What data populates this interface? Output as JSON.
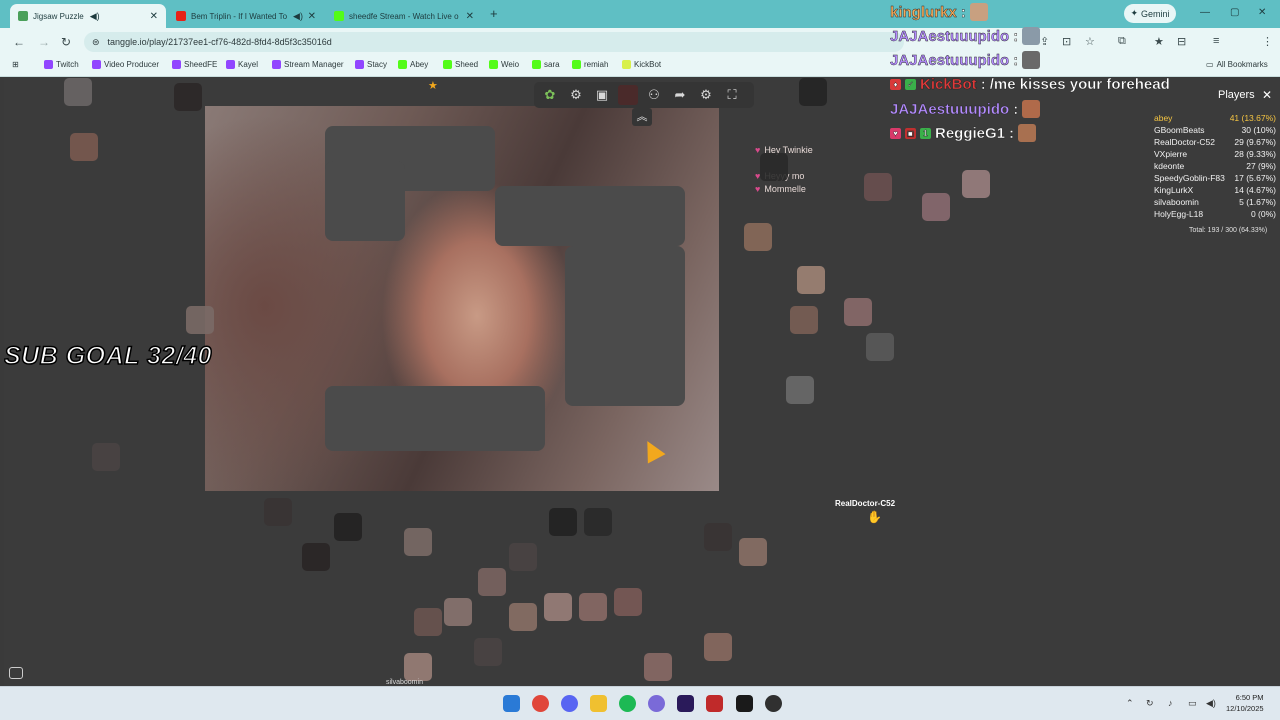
{
  "browser": {
    "tabs": [
      {
        "title": "Jigsaw Puzzle",
        "active": true,
        "color": "#4aa05a"
      },
      {
        "title": "Bem Triplin - If I Wanted To",
        "active": false,
        "color": "#e62117"
      },
      {
        "title": "sheedfe Stream - Watch Live o",
        "active": false,
        "color": "#53fc18"
      }
    ],
    "gemini_label": "Gemini",
    "url": "tanggle.io/play/21737ee1-cf76-482d-8fd4-8d5f3c35016d",
    "bookmarks": [
      {
        "label": "Twitch",
        "color": "#9146ff"
      },
      {
        "label": "Video Producer",
        "color": "#9146ff"
      },
      {
        "label": "SheedFE",
        "color": "#9146ff"
      },
      {
        "label": "Kayel",
        "color": "#9146ff"
      },
      {
        "label": "Stream Manager",
        "color": "#9146ff"
      },
      {
        "label": "Stacy",
        "color": "#9146ff"
      },
      {
        "label": "Abey",
        "color": "#53fc18"
      },
      {
        "label": "Sheed",
        "color": "#53fc18"
      },
      {
        "label": "Weio",
        "color": "#53fc18"
      },
      {
        "label": "sara",
        "color": "#53fc18"
      },
      {
        "label": "remiah",
        "color": "#53fc18"
      },
      {
        "label": "KickBot",
        "color": "#d8f04a"
      }
    ],
    "all_bookmarks_label": "All Bookmarks"
  },
  "overlay": {
    "sub_goal": "SUB GOAL 32/40",
    "chat": [
      {
        "user": "kinglurkx",
        "message": "",
        "user_color": "orange"
      },
      {
        "user": "JAJAestuuupido",
        "message": "",
        "user_color": "purple"
      },
      {
        "user": "JAJAestuuupido",
        "message": "",
        "user_color": "purple"
      },
      {
        "user": "KickBot",
        "message": "/me kisses your forehead",
        "user_color": "red"
      },
      {
        "user": "JAJAestuuupido",
        "message": "",
        "user_color": "purple"
      },
      {
        "user": "ReggieG1",
        "message": "",
        "user_color": "white"
      }
    ]
  },
  "puzzle": {
    "in_puzzle_chat": [
      {
        "user": "",
        "message": "Hey Twinkie"
      },
      {
        "user": "",
        "message": "Heyyy mo"
      },
      {
        "user": "",
        "message": "Mommelle"
      }
    ],
    "players_title": "Players",
    "players": [
      {
        "name": "abey",
        "score": "41 (13.67%)"
      },
      {
        "name": "GBoomBeats",
        "score": "30 (10%)"
      },
      {
        "name": "RealDoctor-C52",
        "score": "29 (9.67%)"
      },
      {
        "name": "VXpierre",
        "score": "28 (9.33%)"
      },
      {
        "name": "kdeonte",
        "score": "27 (9%)"
      },
      {
        "name": "SpeedyGoblin-F83",
        "score": "17 (5.67%)"
      },
      {
        "name": "KingLurkX",
        "score": "14 (4.67%)"
      },
      {
        "name": "silvaboomin",
        "score": "5 (1.67%)"
      },
      {
        "name": "HolyEgg-L18",
        "score": "0 (0%)"
      }
    ],
    "total": "Total: 193 / 300 (64.33%)",
    "cursor_user": "RealDoctor-C52",
    "bottom_user": "silvaboomin"
  },
  "taskbar": {
    "time": "6:50 PM",
    "date": "12/10/2025"
  }
}
